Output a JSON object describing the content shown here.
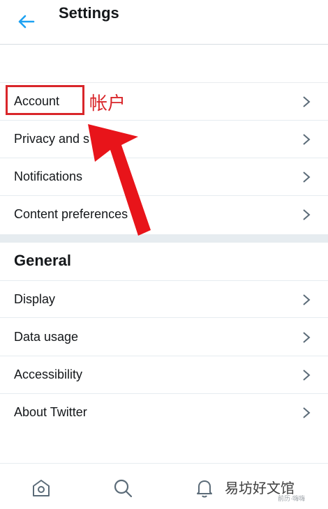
{
  "header": {
    "title": "Settings",
    "back_icon": "arrow-left-icon",
    "accent": "#1da1f2"
  },
  "account_section": {
    "items": [
      {
        "label": "Account"
      },
      {
        "label": "Privacy and s"
      },
      {
        "label": "Notifications"
      },
      {
        "label": "Content preferences"
      }
    ]
  },
  "general_section": {
    "title": "General",
    "items": [
      {
        "label": "Display"
      },
      {
        "label": "Data usage"
      },
      {
        "label": "Accessibility"
      },
      {
        "label": "About Twitter"
      }
    ]
  },
  "annotation": {
    "label": "帐户",
    "color": "#d9262a"
  },
  "bottom_nav": {
    "icons": [
      "home-icon",
      "search-icon",
      "bell-icon"
    ]
  },
  "watermark": {
    "text": "易坊好文馆",
    "small_text": "前历·嗨嗨"
  }
}
